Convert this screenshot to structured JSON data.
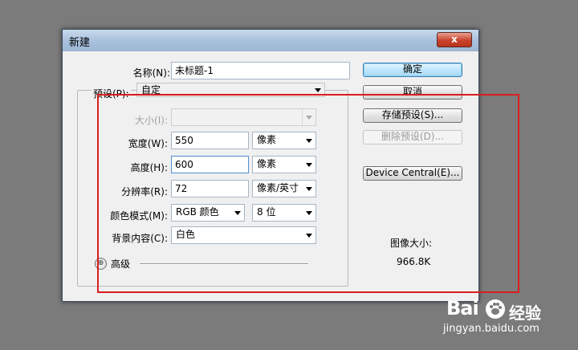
{
  "dialog": {
    "title": "新建",
    "close_glyph": "x"
  },
  "form": {
    "name_label": "名称(N):",
    "name_value": "未标题-1",
    "preset_label": "预设(P):",
    "preset_value": "自定",
    "size_label": "大小(I):",
    "size_value": "",
    "width_label": "宽度(W):",
    "width_value": "550",
    "width_unit": "像素",
    "height_label": "高度(H):",
    "height_value": "600",
    "height_unit": "像素",
    "resolution_label": "分辨率(R):",
    "resolution_value": "72",
    "resolution_unit": "像素/英寸",
    "colormode_label": "颜色模式(M):",
    "colormode_value": "RGB 颜色",
    "bitdepth_value": "8 位",
    "background_label": "背景内容(C):",
    "background_value": "白色",
    "advanced_label": "高级"
  },
  "buttons": {
    "ok": "确定",
    "cancel": "取消",
    "save_preset": "存储预设(S)...",
    "delete_preset": "删除预设(D)...",
    "device_central": "Device Central(E)..."
  },
  "info": {
    "image_size_label": "图像大小:",
    "image_size_value": "966.8K"
  },
  "watermark": {
    "logo": "Bai",
    "brand": "经验",
    "url": "jingyan.baidu.com"
  },
  "colors": {
    "annotation_box": "#d81e1e",
    "background": "#7b7b7b"
  }
}
